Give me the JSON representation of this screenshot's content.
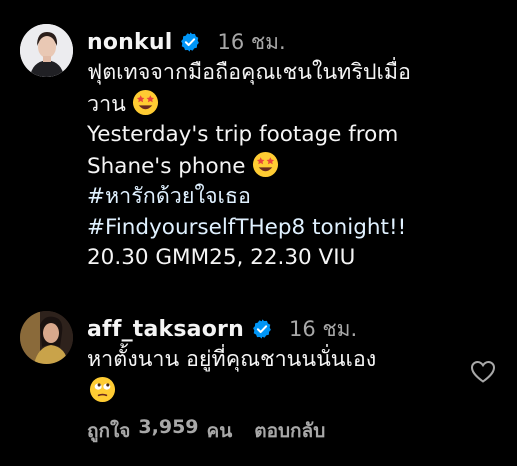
{
  "comments": [
    {
      "username": "nonkul",
      "time": "16 ชม.",
      "lines": [
        "ฟุตเทจจากมือถือคุณเชนในทริปเมื่อ",
        "วาน",
        "Yesterday's trip footage from",
        "Shane's phone",
        "#หารักด้วยใจเธอ",
        "#FindyourselfTHep8 tonight!!",
        "20.30 GMM25, 22.30 VIU"
      ],
      "emoji_icons": [
        "star-struck-emoji-icon",
        "star-struck-emoji-icon"
      ]
    },
    {
      "username": "aff_taksaorn",
      "time": "16 ชม.",
      "lines": [
        "หาตั้งนาน อยู่ที่คุณชานนนั่นเอง"
      ],
      "emoji_icons": [
        "rolling-eyes-emoji-icon"
      ],
      "likes_label": "ถูกใจ",
      "likes_count": "3,959",
      "likes_unit": "คน",
      "reply_label": "ตอบกลับ"
    }
  ],
  "colors": {
    "background": "#000000",
    "text": "#f5f5f5",
    "muted": "#a8a8a8",
    "verified": "#0095f6"
  },
  "icons": [
    "verified-badge-icon",
    "heart-outline-icon"
  ]
}
